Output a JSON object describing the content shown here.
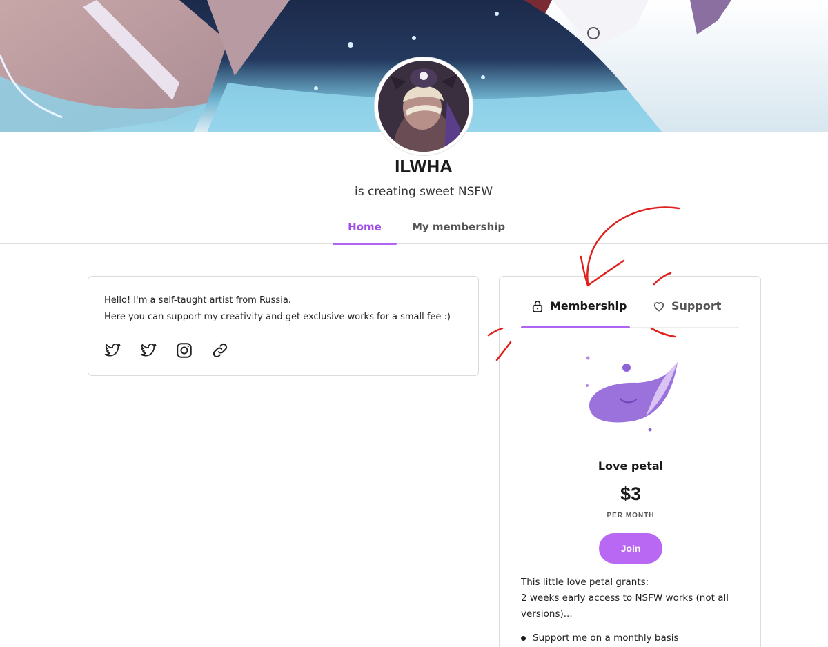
{
  "creator": {
    "name": "ILWHA",
    "tagline": "is creating sweet NSFW"
  },
  "tabs": [
    {
      "label": "Home",
      "active": true
    },
    {
      "label": "My membership",
      "active": false
    }
  ],
  "about": {
    "lines": [
      "Hello! I'm a self-taught artist from Russia.",
      "Here you can support my creativity and get exclusive works for a small fee :)"
    ],
    "social_icons": [
      "twitter-icon",
      "twitter-icon",
      "instagram-icon",
      "link-icon"
    ]
  },
  "membership_panel": {
    "tabs": [
      {
        "label": "Membership",
        "icon": "lock-icon",
        "active": true
      },
      {
        "label": "Support",
        "icon": "heart-icon",
        "active": false
      }
    ],
    "tier": {
      "name": "Love petal",
      "price": "$3",
      "period": "PER MONTH",
      "join_label": "Join",
      "description_lines": [
        "This little love petal grants:",
        "2 weeks early access to NSFW works (not all versions)..."
      ],
      "benefits": [
        "Support me on a monthly basis"
      ]
    }
  },
  "colors": {
    "accent": "#b065f2",
    "join_button": "#b968f4",
    "annotation": "#e0201c"
  }
}
